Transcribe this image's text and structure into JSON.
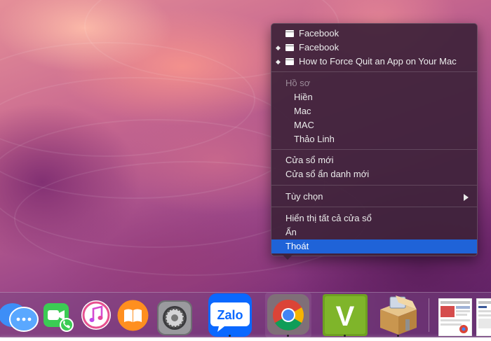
{
  "menu": {
    "windows": [
      {
        "label": "Facebook",
        "marked": false
      },
      {
        "label": "Facebook",
        "marked": true
      },
      {
        "label": "How to Force Quit an App on Your Mac",
        "marked": true
      }
    ],
    "profiles_header": "Hồ sơ",
    "profiles": [
      "Hiền",
      "Mac",
      "MAC",
      "Thảo Linh"
    ],
    "new_window": "Cửa sổ mới",
    "new_incognito_window": "Cửa sổ ẩn danh mới",
    "options": "Tùy chọn",
    "show_all_windows": "Hiển thị tất cả cửa sổ",
    "hide": "Ẩn",
    "quit": "Thoát",
    "marker_glyph": "◆",
    "selected_color": "#1f63d8"
  },
  "dock": {
    "apps": [
      {
        "name": "Messages",
        "icon": "messages-icon"
      },
      {
        "name": "FaceTime",
        "icon": "facetime-icon"
      },
      {
        "name": "iTunes",
        "icon": "itunes-icon"
      },
      {
        "name": "iBooks",
        "icon": "ibooks-icon"
      },
      {
        "name": "System Preferences",
        "icon": "gear-icon"
      },
      {
        "name": "Zalo",
        "icon": "zalo-icon",
        "label": "Zalo"
      },
      {
        "name": "Google Chrome",
        "icon": "chrome-icon"
      },
      {
        "name": "V app",
        "icon": "v-app-icon",
        "label": "V"
      },
      {
        "name": "Archive Utility",
        "icon": "archive-icon"
      }
    ]
  }
}
